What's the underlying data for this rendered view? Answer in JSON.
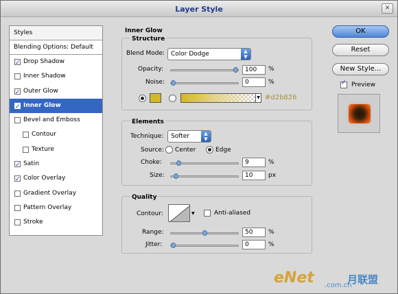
{
  "window": {
    "title": "Layer Style"
  },
  "styles_panel": {
    "header": "Styles",
    "blending_options": "Blending Options: Default",
    "effects": [
      {
        "label": "Drop Shadow",
        "checked": true,
        "active": false,
        "indent": false
      },
      {
        "label": "Inner Shadow",
        "checked": false,
        "active": false,
        "indent": false
      },
      {
        "label": "Outer Glow",
        "checked": true,
        "active": false,
        "indent": false
      },
      {
        "label": "Inner Glow",
        "checked": true,
        "active": true,
        "indent": false
      },
      {
        "label": "Bevel and Emboss",
        "checked": false,
        "active": false,
        "indent": false
      },
      {
        "label": "Contour",
        "checked": false,
        "active": false,
        "indent": true
      },
      {
        "label": "Texture",
        "checked": false,
        "active": false,
        "indent": true
      },
      {
        "label": "Satin",
        "checked": true,
        "active": false,
        "indent": false
      },
      {
        "label": "Color Overlay",
        "checked": true,
        "active": false,
        "indent": false
      },
      {
        "label": "Gradient Overlay",
        "checked": false,
        "active": false,
        "indent": false
      },
      {
        "label": "Pattern Overlay",
        "checked": false,
        "active": false,
        "indent": false
      },
      {
        "label": "Stroke",
        "checked": false,
        "active": false,
        "indent": false
      }
    ]
  },
  "inner_glow": {
    "title": "Inner Glow",
    "structure": {
      "title": "Structure",
      "blend_mode_label": "Blend Mode:",
      "blend_mode_value": "Color Dodge",
      "opacity_label": "Opacity:",
      "opacity_value": "100",
      "opacity_level": 1.0,
      "noise_label": "Noise:",
      "noise_value": "0",
      "noise_level": 0.0,
      "percent": "%",
      "color_hex": "#d2b826"
    },
    "elements": {
      "title": "Elements",
      "technique_label": "Technique:",
      "technique_value": "Softer",
      "source_label": "Source:",
      "source_center": "Center",
      "source_edge": "Edge",
      "choke_label": "Choke:",
      "choke_value": "9",
      "choke_level": 0.09,
      "size_label": "Size:",
      "size_value": "10",
      "size_level": 0.04,
      "percent": "%",
      "px": "px"
    },
    "quality": {
      "title": "Quality",
      "contour_label": "Contour:",
      "anti_aliased": "Anti-aliased",
      "range_label": "Range:",
      "range_value": "50",
      "range_level": 0.5,
      "jitter_label": "Jitter:",
      "jitter_value": "0",
      "jitter_level": 0.0,
      "percent": "%"
    }
  },
  "buttons": {
    "ok": "OK",
    "reset": "Reset",
    "new_style": "New Style...",
    "preview": "Preview"
  },
  "watermark": {
    "brand": "eNet",
    "site": ".com.cn",
    "cn": "月联盟"
  },
  "colors": {
    "accent": "#3367c1",
    "glow": "#d2b826"
  }
}
